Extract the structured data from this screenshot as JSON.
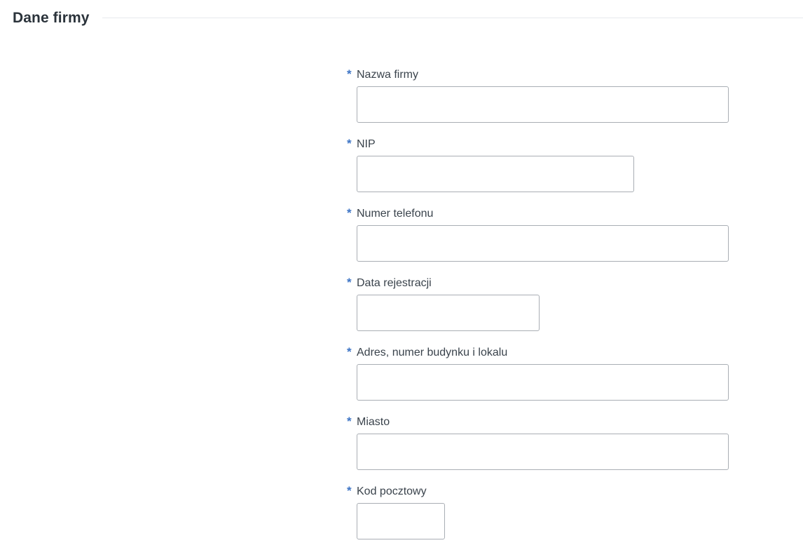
{
  "section": {
    "title": "Dane firmy"
  },
  "required_mark": "*",
  "fields": {
    "company_name": {
      "label": "Nazwa firmy",
      "value": ""
    },
    "nip": {
      "label": "NIP",
      "value": ""
    },
    "phone": {
      "label": "Numer telefonu",
      "value": ""
    },
    "registration_date": {
      "label": "Data rejestracji",
      "value": ""
    },
    "address": {
      "label": "Adres, numer budynku i lokalu",
      "value": ""
    },
    "city": {
      "label": "Miasto",
      "value": ""
    },
    "postal_code": {
      "label": "Kod pocztowy",
      "value": ""
    }
  },
  "colors": {
    "required_mark": "#3d74c5",
    "input_border": "#a9aeb4",
    "divider": "#e7e9ec",
    "title_text": "#2b333b"
  }
}
